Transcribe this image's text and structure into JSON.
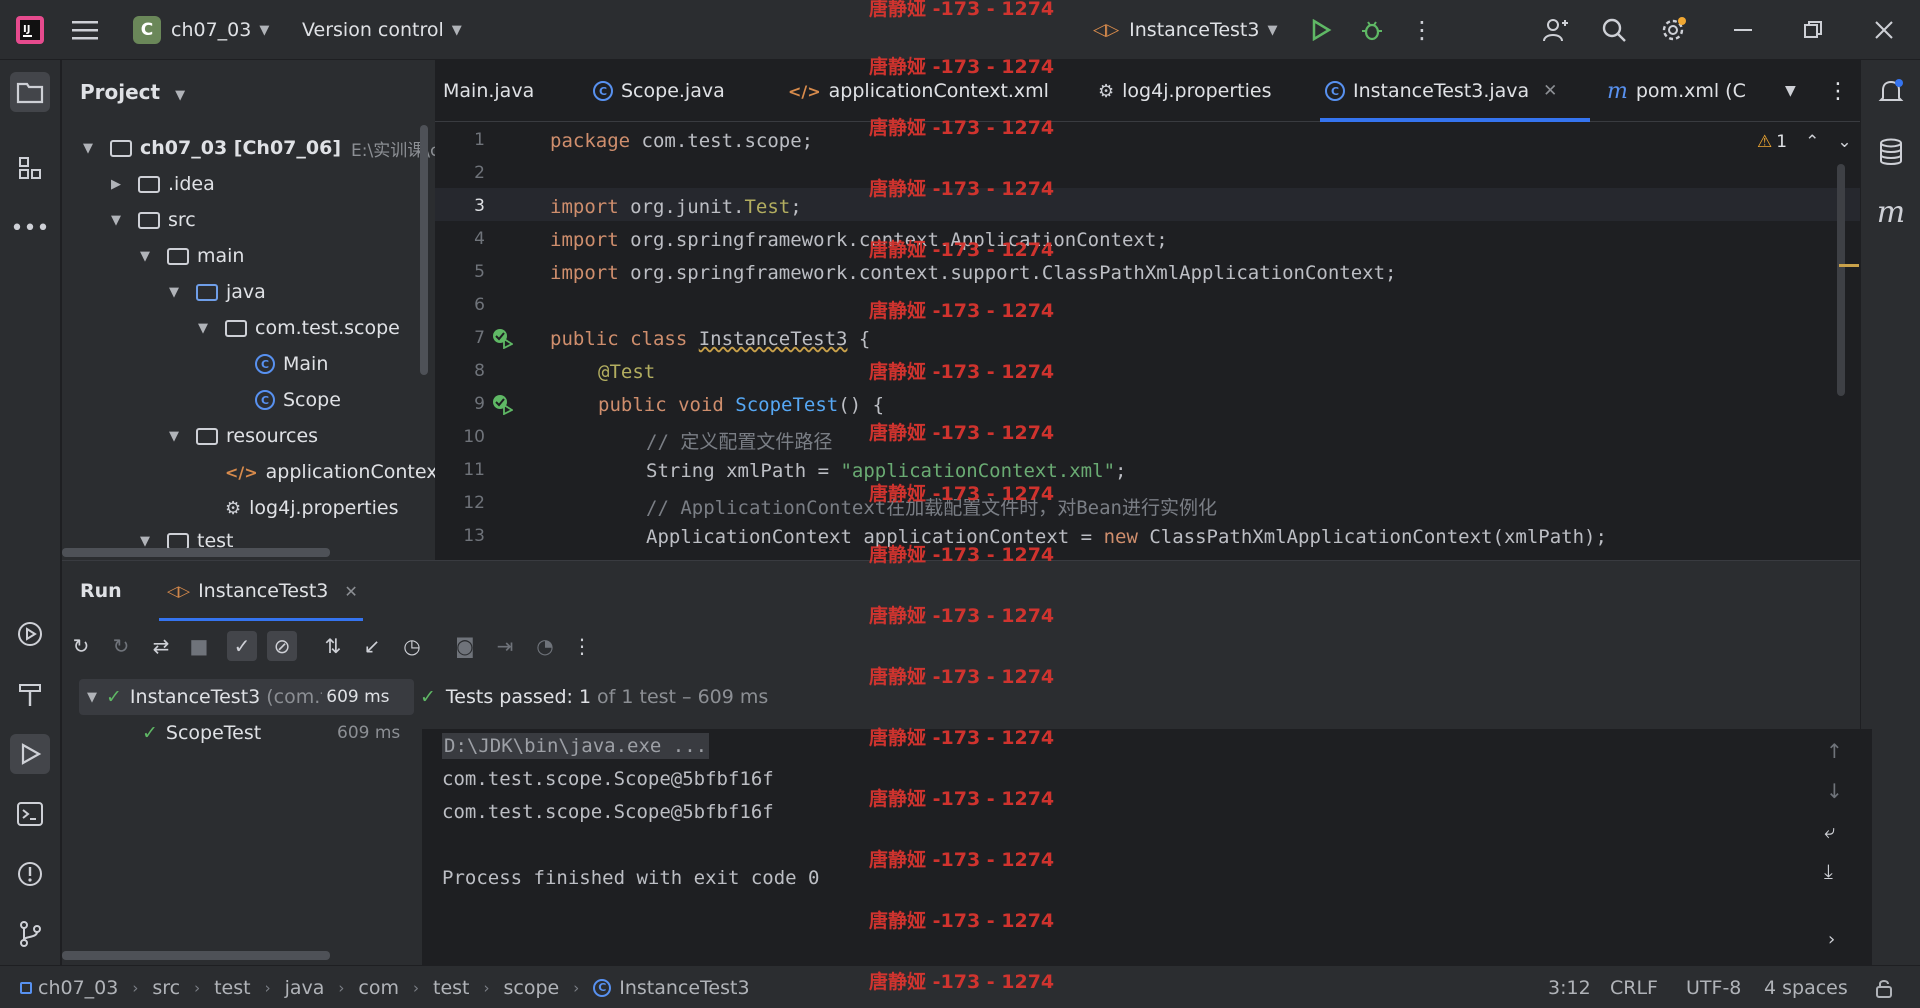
{
  "titlebar": {
    "project_badge": "C",
    "project_name": "ch07_03",
    "version_control": "Version control",
    "run_config": "InstanceTest3"
  },
  "project_panel": {
    "title": "Project",
    "tree": [
      {
        "label": "ch07_03 [Ch07_06]",
        "extra": "E:\\实训课\\c",
        "type": "module"
      },
      {
        "label": ".idea",
        "type": "folder"
      },
      {
        "label": "src",
        "type": "folder"
      },
      {
        "label": "main",
        "type": "folder"
      },
      {
        "label": "java",
        "type": "folder-blue"
      },
      {
        "label": "com.test.scope",
        "type": "package"
      },
      {
        "label": "Main",
        "type": "class"
      },
      {
        "label": "Scope",
        "type": "class"
      },
      {
        "label": "resources",
        "type": "folder"
      },
      {
        "label": "applicationContext.",
        "type": "xml"
      },
      {
        "label": "log4j.properties",
        "type": "props"
      },
      {
        "label": "test",
        "type": "folder"
      }
    ]
  },
  "editor_tabs": [
    {
      "label": "Main.java"
    },
    {
      "label": "Scope.java"
    },
    {
      "label": "applicationContext.xml"
    },
    {
      "label": "log4j.properties"
    },
    {
      "label": "InstanceTest3.java",
      "active": true
    },
    {
      "label": "pom.xml (Ch("
    }
  ],
  "editor": {
    "warning_count": "1",
    "line_numbers": [
      "1",
      "2",
      "3",
      "4",
      "5",
      "6",
      "7",
      "8",
      "9",
      "10",
      "11",
      "12",
      "13"
    ],
    "lines": {
      "l1_kw": "package",
      "l1_rest": " com.test.scope;",
      "l3_kw": "import",
      "l3_rest": " org.junit.",
      "l3_an": "Test",
      "l3_end": ";",
      "l4_kw": "import",
      "l4_rest": " org.springframework.context.ApplicationContext;",
      "l5_kw": "import",
      "l5_rest": " org.springframework.context.support.ClassPathXmlApplicationContext;",
      "l7_kw": "public class",
      "l7_name": "InstanceTest3",
      "l7_end": " {",
      "l8_an": "@Test",
      "l9_kw": "public void",
      "l9_fn": "ScopeTest",
      "l9_end": "() {",
      "l10_cm": "// 定义配置文件路径",
      "l11_a": "String xmlPath = ",
      "l11_str": "\"applicationContext.xml\"",
      "l11_end": ";",
      "l12_cm": "// ApplicationContext在加载配置文件时，对Bean进行实例化",
      "l13_a": "ApplicationContext applicationContext = ",
      "l13_kw": "new",
      "l13_b": " ClassPathXmlApplicationContext(xmlPath);"
    }
  },
  "run_panel": {
    "tab_run": "Run",
    "tab_config": "InstanceTest3",
    "tests": [
      {
        "name": "InstanceTest3",
        "pkg": "(com.t",
        "time": "609 ms"
      },
      {
        "name": "ScopeTest",
        "time": "609 ms"
      }
    ],
    "summary_label": "Tests passed:",
    "summary_count": "1",
    "summary_rest": "of 1 test – 609 ms",
    "console": [
      "D:\\JDK\\bin\\java.exe ...",
      "com.test.scope.Scope@5bfbf16f",
      "com.test.scope.Scope@5bfbf16f",
      "",
      "Process finished with exit code 0"
    ]
  },
  "statusbar": {
    "breadcrumbs": [
      "ch07_03",
      "src",
      "test",
      "java",
      "com",
      "test",
      "scope",
      "InstanceTest3"
    ],
    "position": "3:12",
    "line_sep": "CRLF",
    "encoding": "UTF-8",
    "indent": "4 spaces"
  },
  "watermark": "唐静娅 -173 - 1274",
  "colors": {
    "accent": "#3574f0",
    "watermark": "#d9352f",
    "pass": "#5fb865"
  }
}
